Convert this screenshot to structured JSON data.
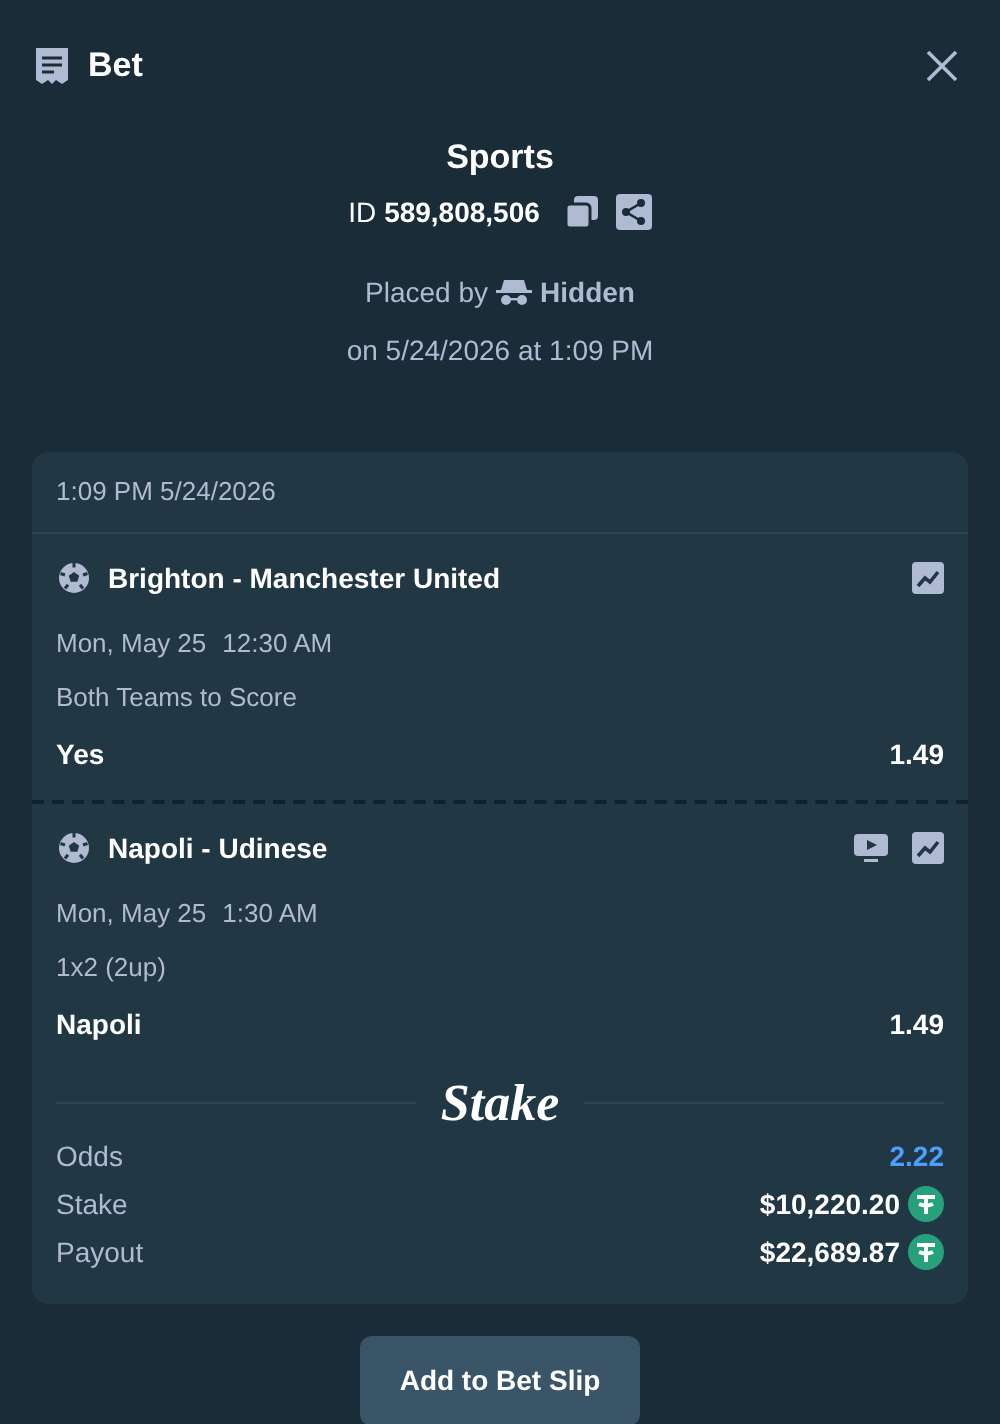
{
  "header": {
    "title": "Bet"
  },
  "summary": {
    "title": "Sports",
    "id_label": "ID",
    "id_value": "589,808,506",
    "placed_by_label": "Placed by",
    "placed_by_user": "Hidden",
    "placed_on": "on 5/24/2026 at 1:09 PM"
  },
  "slip": {
    "timestamp": "1:09 PM 5/24/2026",
    "legs": [
      {
        "match": "Brighton - Manchester United",
        "date": "Mon, May 25",
        "time": "12:30 AM",
        "market": "Both Teams to Score",
        "selection": "Yes",
        "odds": "1.49",
        "stream": false
      },
      {
        "match": "Napoli - Udinese",
        "date": "Mon, May 25",
        "time": "1:30 AM",
        "market": "1x2 (2up)",
        "selection": "Napoli",
        "odds": "1.49",
        "stream": true
      }
    ],
    "logo": "Stake",
    "totals": [
      {
        "label": "Odds",
        "value": "2.22",
        "kind": "odds"
      },
      {
        "label": "Stake",
        "value": "$10,220.20",
        "kind": "amount"
      },
      {
        "label": "Payout",
        "value": "$22,689.87",
        "kind": "amount"
      }
    ]
  },
  "button": "Add to Bet Slip"
}
